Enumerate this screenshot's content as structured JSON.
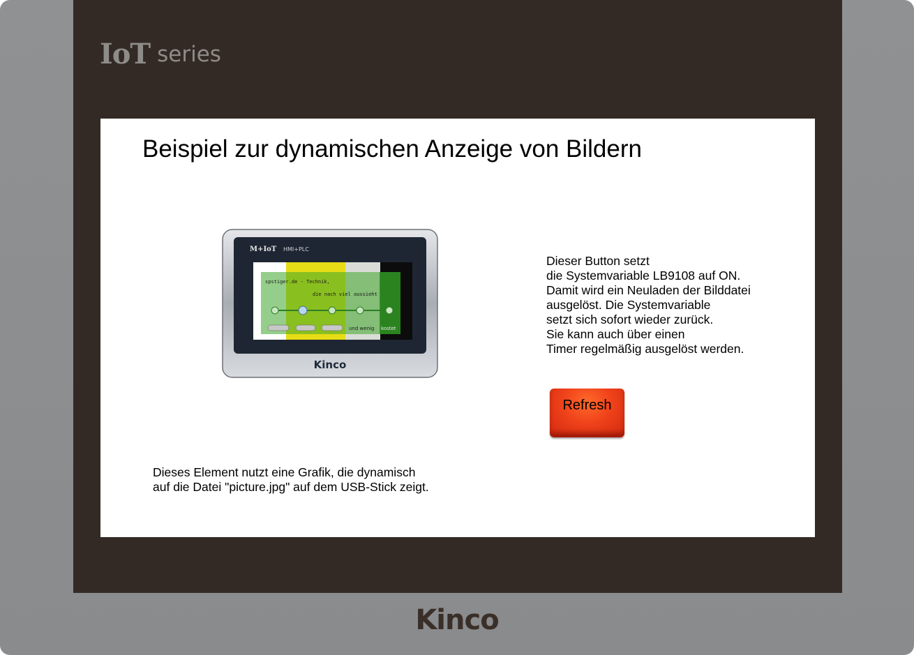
{
  "device": {
    "logo_mark": "IoT",
    "logo_series": "series",
    "brand": "Kinco",
    "frame_color": "#8f9193",
    "bezel_color": "#332a25"
  },
  "screen": {
    "title": "Beispiel zur dynamischen Anzeige von Bildern",
    "image": {
      "top_label": "M+IoT",
      "top_sublabel": "HMI+PLC",
      "inner_line1": "spstiger.de - Technik,",
      "inner_line2": "die nach viel aussieht",
      "inner_bottom_text": "und wenig",
      "inner_bottom_text2": "kostet",
      "brand": "Kinco"
    },
    "description_right": "Dieser Button setzt\ndie Systemvariable LB9108 auf ON.\nDamit wird ein Neuladen der Bilddatei\nausgelöst. Die Systemvariable\nsetzt sich sofort wieder zurück.\nSie kann auch über einen\nTimer regelmäßig ausgelöst werden.",
    "refresh_button": {
      "label": "Refresh",
      "color": "#f0431b"
    },
    "description_bottom": "Dieses Element nutzt eine Grafik, die dynamisch\nauf die Datei \"picture.jpg\" auf dem USB-Stick zeigt."
  }
}
